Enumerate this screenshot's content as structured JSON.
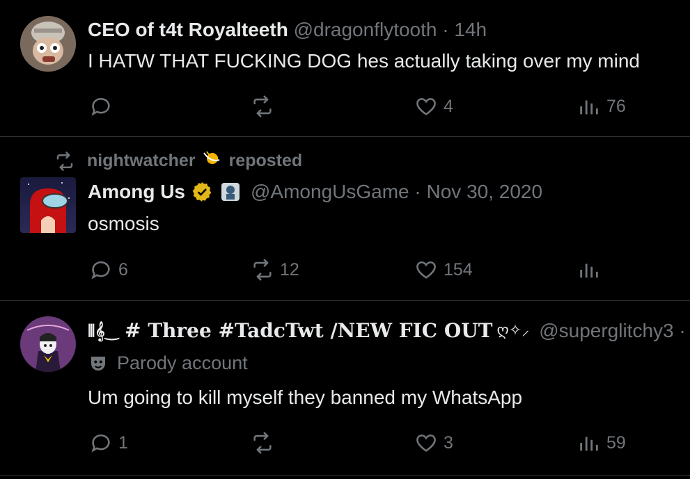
{
  "tweets": [
    {
      "name": "CEO of t4t Royalteeth",
      "handle": "@dragonflytooth",
      "time": "14h",
      "text": "I HATW THAT FUCKING DOG hes actually taking over my mind",
      "replies": "",
      "reposts": "",
      "likes": "4",
      "views": "76"
    },
    {
      "repost_by": "nightwatcher",
      "repost_label": "reposted",
      "name": "Among Us",
      "handle": "@AmongUsGame",
      "time": "Nov 30, 2020",
      "text": "osmosis",
      "replies": "6",
      "reposts": "12",
      "likes": "154",
      "views": ""
    },
    {
      "name_part1": "# Three #TadcTwt /NEW FIC OUT",
      "handle": "@superglitchy3 ·",
      "badge": "Parody account",
      "text": "Um going to kill myself they banned my WhatsApp",
      "replies": "1",
      "reposts": "",
      "likes": "3",
      "views": "59"
    }
  ],
  "colors": {
    "background": "#000000",
    "text": "#e7e9ea",
    "muted": "#71767b",
    "divider": "#2f3336",
    "verified": "#e2b719"
  }
}
